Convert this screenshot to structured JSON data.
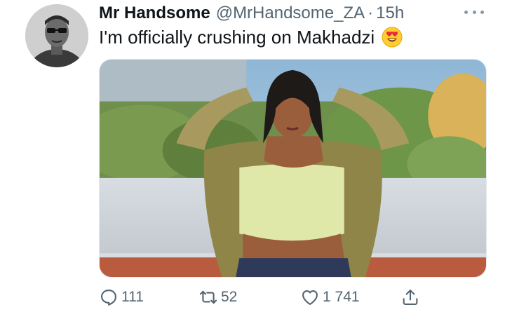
{
  "tweet": {
    "display_name": "Mr Handsome",
    "handle": "@MrHandsome_ZA",
    "separator": "·",
    "timestamp": "15h",
    "text": "I'm officially crushing on Makhadzi",
    "emoji": "smiling-face-with-heart-eyes"
  },
  "actions": {
    "reply_count": "111",
    "retweet_count": "52",
    "like_count": "1 741"
  },
  "icons": {
    "reply": "reply-icon",
    "retweet": "retweet-icon",
    "like": "heart-icon",
    "share": "share-icon",
    "more": "more-icon"
  },
  "colors": {
    "text_primary": "#0f1419",
    "text_secondary": "#536471",
    "icon_gray": "#536471"
  }
}
